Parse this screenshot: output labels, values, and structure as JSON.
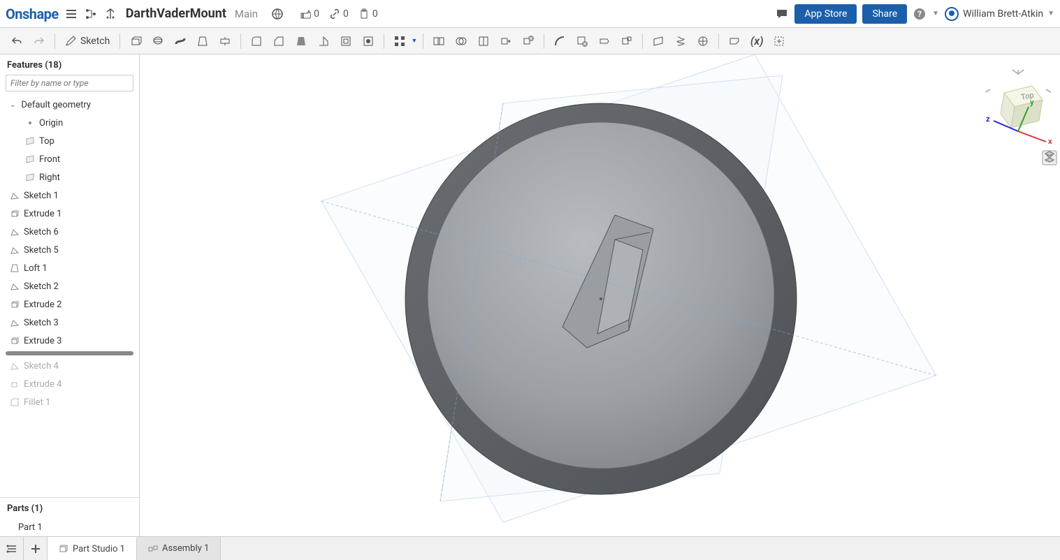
{
  "app": {
    "logo": "Onshape"
  },
  "document": {
    "title": "DarthVaderMount",
    "branch": "Main"
  },
  "stats": {
    "likes": "0",
    "links": "0",
    "copies": "0"
  },
  "buttons": {
    "appstore": "App Store",
    "share": "Share"
  },
  "user": {
    "name": "William Brett-Atkin"
  },
  "toolbar": {
    "sketch": "Sketch"
  },
  "sidebar": {
    "features_title": "Features (18)",
    "filter_placeholder": "Filter by name or type",
    "default_geom": "Default geometry",
    "geom": {
      "origin": "Origin",
      "top": "Top",
      "front": "Front",
      "right": "Right"
    },
    "items": [
      {
        "label": "Sketch 1",
        "icon": "sketch",
        "suppressed": false
      },
      {
        "label": "Extrude 1",
        "icon": "extrude",
        "suppressed": false
      },
      {
        "label": "Sketch 6",
        "icon": "sketch",
        "suppressed": false
      },
      {
        "label": "Sketch 5",
        "icon": "sketch",
        "suppressed": false
      },
      {
        "label": "Loft 1",
        "icon": "loft",
        "suppressed": false
      },
      {
        "label": "Sketch 2",
        "icon": "sketch",
        "suppressed": false
      },
      {
        "label": "Extrude 2",
        "icon": "extrude",
        "suppressed": false
      },
      {
        "label": "Sketch 3",
        "icon": "sketch",
        "suppressed": false
      },
      {
        "label": "Extrude 3",
        "icon": "extrude",
        "suppressed": false
      }
    ],
    "suppressed_items": [
      {
        "label": "Sketch 4",
        "icon": "sketch"
      },
      {
        "label": "Extrude 4",
        "icon": "extrude"
      },
      {
        "label": "Fillet 1",
        "icon": "fillet"
      }
    ],
    "parts_title": "Parts (1)",
    "parts": [
      {
        "label": "Part 1"
      }
    ]
  },
  "viewcube": {
    "face": "Top",
    "axes": {
      "x": "x",
      "y": "y",
      "z": "z"
    }
  },
  "tabs": {
    "part_studio": "Part Studio 1",
    "assembly": "Assembly 1"
  }
}
